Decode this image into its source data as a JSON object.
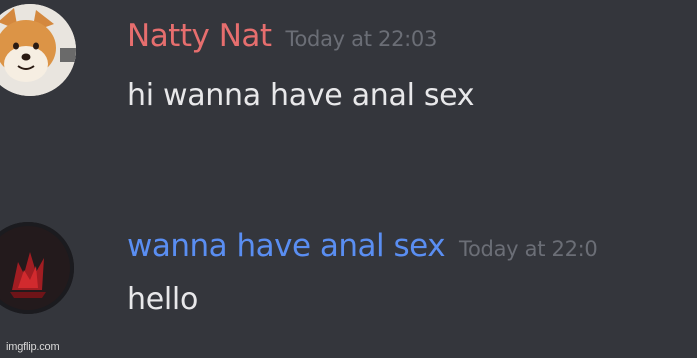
{
  "messages": [
    {
      "username": "Natty Nat",
      "timestamp": "Today at 22:03",
      "content": "hi wanna have anal sex",
      "avatar_icon": "shiba-dog-avatar",
      "username_color": "#e66e6e"
    },
    {
      "username": "wanna have anal sex",
      "timestamp": "Today at 22:0",
      "content": "hello",
      "avatar_icon": "red-flower-avatar",
      "username_color": "#5a8ef2"
    }
  ],
  "watermark": "imgflip.com",
  "colors": {
    "background": "#34363c",
    "message_text": "#e8e8ea",
    "timestamp_text": "#6b6e76"
  }
}
